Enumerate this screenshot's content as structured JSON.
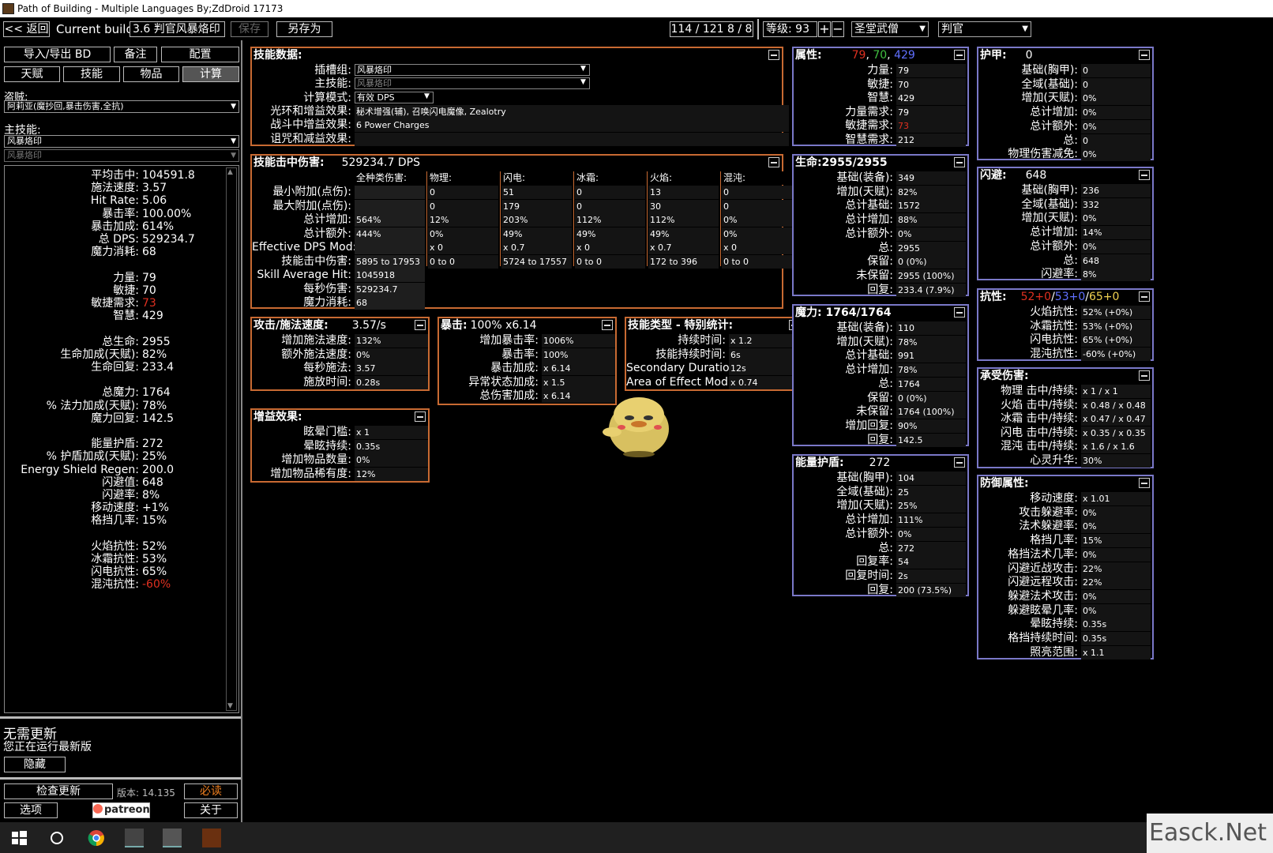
{
  "window": {
    "title": "Path of Building - Multiple Languages By;ZdDroid  17173"
  },
  "topbar": {
    "back": "<< 返回",
    "current_build_label": "Current build:",
    "build_name": "3.6 判官风暴烙印",
    "save": "保存",
    "save_as": "另存为",
    "points": "114 / 121   8 / 8",
    "level_label": "等级: 93",
    "class": "圣堂武僧",
    "ascendancy": "判官"
  },
  "left": {
    "buttons": {
      "import_export": "导入/导出 BD",
      "notes": "备注",
      "config": "配置",
      "tree": "天赋",
      "skills": "技能",
      "items": "物品",
      "calcs": "计算"
    },
    "bandit_label": "盗贼:",
    "bandit_value": "阿莉亚(魔抄回,暴击伤害,全抗)",
    "main_skill_label": "主技能:",
    "main_skill_value": "风暴烙印",
    "main_skill_sub": "风暴烙印",
    "stats": [
      {
        "label": "平均击中:",
        "value": "104591.8"
      },
      {
        "label": "施法速度:",
        "value": "3.57"
      },
      {
        "label": "Hit Rate:",
        "value": "5.06"
      },
      {
        "label": "暴击率:",
        "value": "100.00%"
      },
      {
        "label": "暴击加成:",
        "value": "614%"
      },
      {
        "label": "总 DPS:",
        "value": "529234.7"
      },
      {
        "label": "魔力消耗:",
        "value": "68"
      },
      {
        "label": "",
        "value": ""
      },
      {
        "label": "力量:",
        "value": "79"
      },
      {
        "label": "敏捷:",
        "value": "70"
      },
      {
        "label": "敏捷需求:",
        "value": "73"
      },
      {
        "label": "智慧:",
        "value": "429"
      },
      {
        "label": "",
        "value": ""
      },
      {
        "label": "总生命:",
        "value": "2955"
      },
      {
        "label": "生命加成(天赋):",
        "value": "82%"
      },
      {
        "label": "生命回复:",
        "value": "233.4"
      },
      {
        "label": "",
        "value": ""
      },
      {
        "label": "总魔力:",
        "value": "1764"
      },
      {
        "label": "% 法力加成(天赋):",
        "value": "78%"
      },
      {
        "label": "魔力回复:",
        "value": "142.5"
      },
      {
        "label": "",
        "value": ""
      },
      {
        "label": "能量护盾:",
        "value": "272"
      },
      {
        "label": "% 护盾加成(天赋):",
        "value": "25%"
      },
      {
        "label": "Energy Shield Regen:",
        "value": "200.0"
      },
      {
        "label": "闪避值:",
        "value": "648"
      },
      {
        "label": "闪避率:",
        "value": "8%"
      },
      {
        "label": "移动速度:",
        "value": "+1%"
      },
      {
        "label": "格挡几率:",
        "value": "15%"
      },
      {
        "label": "",
        "value": ""
      },
      {
        "label": "火焰抗性:",
        "value": "52%"
      },
      {
        "label": "冰霜抗性:",
        "value": "53%"
      },
      {
        "label": "闪电抗性:",
        "value": "65%"
      },
      {
        "label": "混沌抗性:",
        "value": "-60%"
      }
    ],
    "update_title": "无需更新",
    "update_sub": "您正在运行最新版",
    "hide": "隐藏",
    "check_update": "检查更新",
    "version": "版本: 14.135",
    "must_read": "必读",
    "options": "选项",
    "patreon": "patreon",
    "about": "关于"
  },
  "skill_data": {
    "title": "技能数据:",
    "rows": [
      {
        "label": "插槽组:",
        "value": "风暴烙印"
      },
      {
        "label": "主技能:",
        "value": "风暴烙印"
      },
      {
        "label": "计算模式:",
        "value": "有效 DPS"
      },
      {
        "label": "光环和增益效果:",
        "value": "秘术增强(辅), 召唤闪电魔像, Zealotry"
      },
      {
        "label": "战斗中增益效果:",
        "value": "6 Power Charges"
      },
      {
        "label": "诅咒和减益效果:",
        "value": ""
      }
    ]
  },
  "hit_damage": {
    "title": "技能击中伤害:",
    "dps": "529234.7 DPS",
    "columns": [
      "全种类伤害:",
      "物理:",
      "闪电:",
      "冰霜:",
      "火焰:",
      "混沌:"
    ],
    "rows": [
      {
        "label": "最小附加(点伤):",
        "cells": [
          "",
          "0",
          "51",
          "0",
          "13",
          "0"
        ]
      },
      {
        "label": "最大附加(点伤):",
        "cells": [
          "",
          "0",
          "179",
          "0",
          "30",
          "0"
        ]
      },
      {
        "label": "总计增加:",
        "cells": [
          "564%",
          "12%",
          "203%",
          "112%",
          "112%",
          "0%"
        ]
      },
      {
        "label": "总计额外:",
        "cells": [
          "444%",
          "0%",
          "49%",
          "49%",
          "49%",
          "0%"
        ]
      },
      {
        "label": "Effective DPS Mod:",
        "cells": [
          "",
          "x 0",
          "x 0.7",
          "x 0",
          "x 0.7",
          "x 0"
        ]
      },
      {
        "label": "技能击中伤害:",
        "cells": [
          "5895 to 17953",
          "0 to 0",
          "5724 to 17557",
          "0 to 0",
          "172 to 396",
          "0 to 0"
        ]
      },
      {
        "label": "Skill Average Hit:",
        "cells": [
          "1045918"
        ]
      },
      {
        "label": "每秒伤害:",
        "cells": [
          "529234.7"
        ]
      },
      {
        "label": "魔力消耗:",
        "cells": [
          "68"
        ]
      }
    ]
  },
  "speed": {
    "title": "攻击/施法速度:",
    "value": "3.57/s",
    "rows": [
      {
        "label": "增加施法速度:",
        "value": "132%"
      },
      {
        "label": "额外施法速度:",
        "value": "0%"
      },
      {
        "label": "每秒施法:",
        "value": "3.57"
      },
      {
        "label": "施放时间:",
        "value": "0.28s"
      }
    ]
  },
  "crit": {
    "title": "暴击:",
    "value": "100% x6.14",
    "rows": [
      {
        "label": "增加暴击率:",
        "value": "1006%"
      },
      {
        "label": "暴击率:",
        "value": "100%"
      },
      {
        "label": "暴击加成:",
        "value": "x 6.14"
      },
      {
        "label": "异常状态加成:",
        "value": "x 1.5"
      },
      {
        "label": "总伤害加成:",
        "value": "x 6.14"
      }
    ]
  },
  "skilltype": {
    "title": "技能类型 - 特别统计:",
    "rows": [
      {
        "label": "持续时间:",
        "value": "x 1.2"
      },
      {
        "label": "技能持续时间:",
        "value": "6s"
      },
      {
        "label": "Secondary Duration:",
        "value": "12s"
      },
      {
        "label": "Area of Effect Mod:",
        "value": "x 0.74"
      }
    ]
  },
  "buffs": {
    "title": "增益效果:",
    "rows": [
      {
        "label": "眩晕门槛:",
        "value": "x 1"
      },
      {
        "label": "晕眩持续:",
        "value": "0.35s"
      },
      {
        "label": "增加物品数量:",
        "value": "0%"
      },
      {
        "label": "增加物品稀有度:",
        "value": "12%"
      }
    ]
  },
  "attributes": {
    "title": "属性:",
    "str": "79",
    "dex": "70",
    "int": "429",
    "rows": [
      {
        "label": "力量:",
        "value": "79"
      },
      {
        "label": "敏捷:",
        "value": "70"
      },
      {
        "label": "智慧:",
        "value": "429"
      },
      {
        "label": "力量需求:",
        "value": "79"
      },
      {
        "label": "敏捷需求:",
        "value": "73"
      },
      {
        "label": "智慧需求:",
        "value": "212"
      }
    ]
  },
  "life": {
    "title": "生命:2955/2955",
    "rows": [
      {
        "label": "基础(装备):",
        "value": "349"
      },
      {
        "label": "增加(天赋):",
        "value": "82%"
      },
      {
        "label": "总计基础:",
        "value": "1572"
      },
      {
        "label": "总计增加:",
        "value": "88%"
      },
      {
        "label": "总计额外:",
        "value": "0%"
      },
      {
        "label": "总:",
        "value": "2955"
      },
      {
        "label": "保留:",
        "value": "0 (0%)"
      },
      {
        "label": "未保留:",
        "value": "2955 (100%)"
      },
      {
        "label": "回复:",
        "value": "233.4 (7.9%)"
      }
    ]
  },
  "mana": {
    "title": "魔力:  1764/1764",
    "rows": [
      {
        "label": "基础(装备):",
        "value": "110"
      },
      {
        "label": "增加(天赋):",
        "value": "78%"
      },
      {
        "label": "总计基础:",
        "value": "991"
      },
      {
        "label": "总计增加:",
        "value": "78%"
      },
      {
        "label": "总:",
        "value": "1764"
      },
      {
        "label": "保留:",
        "value": "0 (0%)"
      },
      {
        "label": "未保留:",
        "value": "1764 (100%)"
      },
      {
        "label": "增加回复:",
        "value": "90%"
      },
      {
        "label": "回复:",
        "value": "142.5"
      }
    ]
  },
  "es": {
    "title": "能量护盾:",
    "value": "272",
    "rows": [
      {
        "label": "基础(胸甲):",
        "value": "104"
      },
      {
        "label": "全域(基础):",
        "value": "25"
      },
      {
        "label": "增加(天赋):",
        "value": "25%"
      },
      {
        "label": "总计增加:",
        "value": "111%"
      },
      {
        "label": "总计额外:",
        "value": "0%"
      },
      {
        "label": "总:",
        "value": "272"
      },
      {
        "label": "回复率:",
        "value": "54"
      },
      {
        "label": "回复时间:",
        "value": "2s"
      },
      {
        "label": "回复:",
        "value": "200 (73.5%)"
      }
    ]
  },
  "armour": {
    "title": "护甲:",
    "value": "0",
    "rows": [
      {
        "label": "基础(胸甲):",
        "value": "0"
      },
      {
        "label": "全域(基础):",
        "value": "0"
      },
      {
        "label": "增加(天赋):",
        "value": "0%"
      },
      {
        "label": "总计增加:",
        "value": "0%"
      },
      {
        "label": "总计额外:",
        "value": "0%"
      },
      {
        "label": "总:",
        "value": "0"
      },
      {
        "label": "物理伤害减免:",
        "value": "0%"
      }
    ]
  },
  "evasion": {
    "title": "闪避:",
    "value": "648",
    "rows": [
      {
        "label": "基础(胸甲):",
        "value": "236"
      },
      {
        "label": "全域(基础):",
        "value": "332"
      },
      {
        "label": "增加(天赋):",
        "value": "0%"
      },
      {
        "label": "总计增加:",
        "value": "14%"
      },
      {
        "label": "总计额外:",
        "value": "0%"
      },
      {
        "label": "总:",
        "value": "648"
      },
      {
        "label": "闪避率:",
        "value": "8%"
      }
    ]
  },
  "resist": {
    "title": "抗性:",
    "fire": "52+0",
    "cold": "53+0",
    "light": "65+0",
    "rows": [
      {
        "label": "火焰抗性:",
        "value": "52% (+0%)"
      },
      {
        "label": "冰霜抗性:",
        "value": "53% (+0%)"
      },
      {
        "label": "闪电抗性:",
        "value": "65% (+0%)"
      },
      {
        "label": "混沌抗性:",
        "value": "-60% (+0%)"
      }
    ]
  },
  "taken": {
    "title": "承受伤害:",
    "rows": [
      {
        "label": "物理 击中/持续:",
        "value": "x 1 / x 1"
      },
      {
        "label": "火焰 击中/持续:",
        "value": "x 0.48 / x 0.48"
      },
      {
        "label": "冰霜 击中/持续:",
        "value": "x 0.47 / x 0.47"
      },
      {
        "label": "闪电 击中/持续:",
        "value": "x 0.35 / x 0.35"
      },
      {
        "label": "混沌 击中/持续:",
        "value": "x 1.6 / x 1.6"
      },
      {
        "label": "心灵升华:",
        "value": "30%"
      }
    ]
  },
  "defence": {
    "title": "防御属性:",
    "rows": [
      {
        "label": "移动速度:",
        "value": "x 1.01"
      },
      {
        "label": "攻击躲避率:",
        "value": "0%"
      },
      {
        "label": "法术躲避率:",
        "value": "0%"
      },
      {
        "label": "格挡几率:",
        "value": "15%"
      },
      {
        "label": "格挡法术几率:",
        "value": "0%"
      },
      {
        "label": "闪避近战攻击:",
        "value": "22%"
      },
      {
        "label": "闪避远程攻击:",
        "value": "22%"
      },
      {
        "label": "躲避法术攻击:",
        "value": "0%"
      },
      {
        "label": "躲避眩晕几率:",
        "value": "0%"
      },
      {
        "label": "晕眩持续:",
        "value": "0.35s"
      },
      {
        "label": "格挡持续时间:",
        "value": "0.35s"
      },
      {
        "label": "照亮范围:",
        "value": "x 1.1"
      }
    ]
  },
  "watermark": "Easck.Net"
}
